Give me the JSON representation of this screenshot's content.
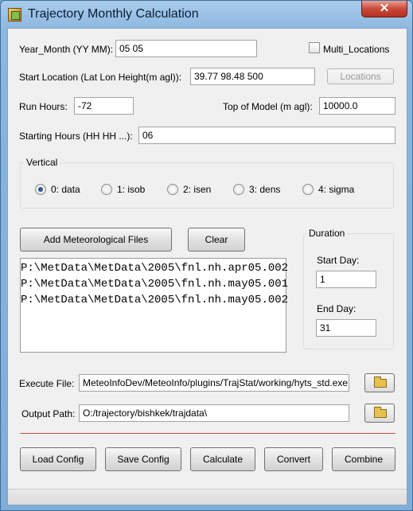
{
  "window": {
    "title": "Trajectory Monthly Calculation",
    "close_label": "✕"
  },
  "year_month": {
    "label": "Year_Month (YY MM):",
    "value": "05 05"
  },
  "multi_locations": {
    "label": "Multi_Locations",
    "checked": false
  },
  "start_location": {
    "label": "Start Location (Lat Lon Height(m agl)):",
    "value": "39.77 98.48 500",
    "locations_button": "Locations"
  },
  "run_hours": {
    "label": "Run Hours:",
    "value": "-72"
  },
  "top_of_model": {
    "label": "Top of Model (m agl):",
    "value": "10000.0"
  },
  "starting_hours": {
    "label": "Starting Hours (HH HH ...):",
    "value": "06"
  },
  "vertical": {
    "title": "Vertical",
    "options": [
      {
        "label": "0: data",
        "selected": true
      },
      {
        "label": "1: isob",
        "selected": false
      },
      {
        "label": "2: isen",
        "selected": false
      },
      {
        "label": "3: dens",
        "selected": false
      },
      {
        "label": "4: sigma",
        "selected": false
      }
    ]
  },
  "met_files": {
    "add_button": "Add Meteorological Files",
    "clear_button": "Clear",
    "files": [
      "P:\\MetData\\MetData\\2005\\fnl.nh.apr05.002",
      "P:\\MetData\\MetData\\2005\\fnl.nh.may05.001",
      "P:\\MetData\\MetData\\2005\\fnl.nh.may05.002"
    ]
  },
  "duration": {
    "title": "Duration",
    "start_day_label": "Start Day:",
    "start_day": "1",
    "end_day_label": "End Day:",
    "end_day": "31"
  },
  "execute_file": {
    "label": "Execute File:",
    "value": "MeteoInfoDev/MeteoInfo/plugins/TrajStat/working/hyts_std.exe"
  },
  "output_path": {
    "label": "Output Path:",
    "value": "O:/trajectory/bishkek/trajdata\\"
  },
  "actions": {
    "load_config": "Load Config",
    "save_config": "Save Config",
    "calculate": "Calculate",
    "convert": "Convert",
    "combine": "Combine"
  },
  "icons": {
    "folder": "folder-open-icon",
    "app": "app-icon"
  }
}
